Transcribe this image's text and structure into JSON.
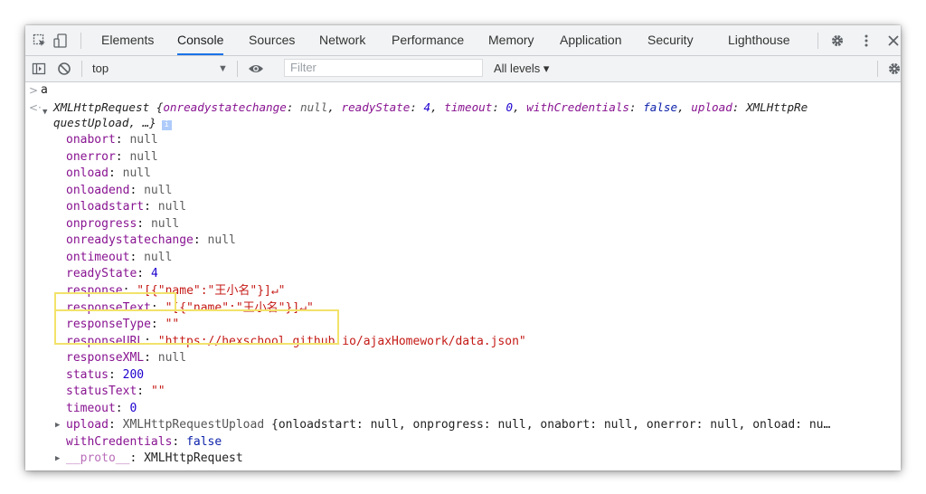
{
  "tabs": [
    "Elements",
    "Console",
    "Sources",
    "Network",
    "Performance",
    "Memory",
    "Application",
    "Security",
    "Lighthouse"
  ],
  "toolbar": {
    "context": "top",
    "filter_placeholder": "Filter",
    "levels": "All levels ▾"
  },
  "console": {
    "input": "a",
    "summary_line1": "XMLHttpRequest {onreadystatechange: null, readyState: 4, timeout: 0, withCredentials: false, upload: XMLHttpRe",
    "summary_line2": "questUpload, …}",
    "props": [
      {
        "k": "onabort",
        "v": "null"
      },
      {
        "k": "onerror",
        "v": "null"
      },
      {
        "k": "onload",
        "v": "null"
      },
      {
        "k": "onloadend",
        "v": "null"
      },
      {
        "k": "onloadstart",
        "v": "null"
      },
      {
        "k": "onprogress",
        "v": "null"
      },
      {
        "k": "onreadystatechange",
        "v": "null"
      },
      {
        "k": "ontimeout",
        "v": "null"
      },
      {
        "k": "readyState",
        "v": "4"
      },
      {
        "k": "response",
        "v": "\"[{\"name\":\"王小名\"}]↵\""
      },
      {
        "k": "responseText",
        "v": "\"[{\"name\":\"王小名\"}]↵\""
      },
      {
        "k": "responseType",
        "v": "\"\""
      },
      {
        "k": "responseURL",
        "v": "\"https://hexschool.github.io/ajaxHomework/data.json\""
      },
      {
        "k": "responseXML",
        "v": "null"
      },
      {
        "k": "status",
        "v": "200"
      },
      {
        "k": "statusText",
        "v": "\"\""
      },
      {
        "k": "timeout",
        "v": "0"
      },
      {
        "k": "upload",
        "v": "XMLHttpRequestUpload {onloadstart: null, onprogress: null, onabort: null, onerror: null, onload: nu…"
      },
      {
        "k": "withCredentials",
        "v": "false"
      },
      {
        "k": "__proto__",
        "v": "XMLHttpRequest"
      }
    ]
  }
}
